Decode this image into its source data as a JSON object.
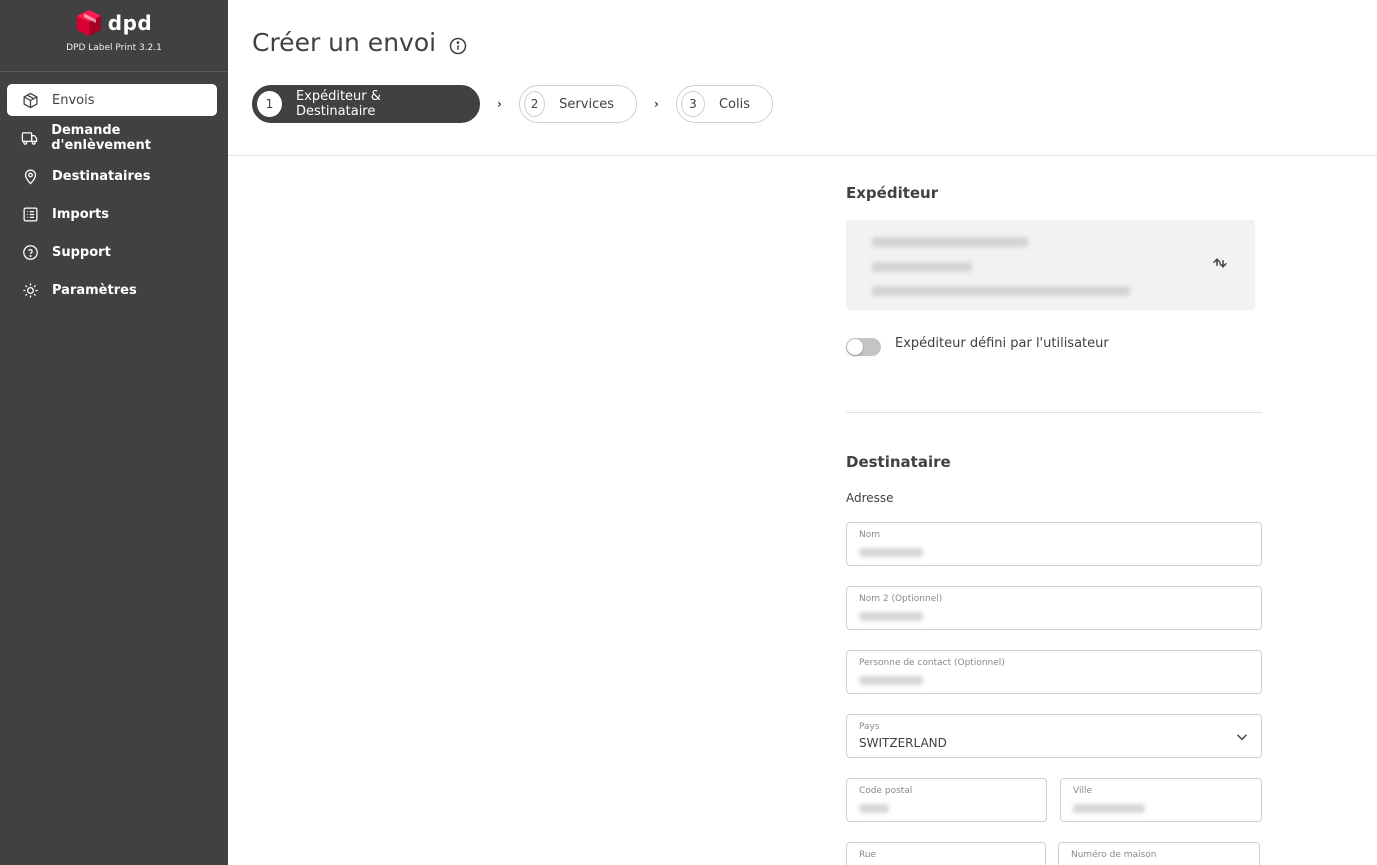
{
  "app": {
    "brand_name": "dpd",
    "version": "DPD Label Print 3.2.1"
  },
  "sidebar": {
    "items": [
      {
        "label": "Envois",
        "icon": "box-icon",
        "active": true
      },
      {
        "label": "Demande d'enlèvement",
        "icon": "truck-icon",
        "active": false
      },
      {
        "label": "Destinataires",
        "icon": "location-pin-icon",
        "active": false
      },
      {
        "label": "Imports",
        "icon": "list-icon",
        "active": false
      },
      {
        "label": "Support",
        "icon": "help-circle-icon",
        "active": false
      },
      {
        "label": "Paramètres",
        "icon": "gear-icon",
        "active": false
      }
    ]
  },
  "header": {
    "title": "Créer un envoi",
    "steps": [
      {
        "number": "1",
        "label": "Expéditeur & Destinataire",
        "active": true
      },
      {
        "number": "2",
        "label": "Services",
        "active": false
      },
      {
        "number": "3",
        "label": "Colis",
        "active": false
      }
    ]
  },
  "sender": {
    "title": "Expéditeur",
    "toggle_label": "Expéditeur défini par l'utilisateur",
    "toggle_on": false
  },
  "recipient": {
    "title": "Destinataire",
    "address_label": "Adresse",
    "fields": {
      "nom": {
        "label": "Nom"
      },
      "nom2": {
        "label": "Nom 2 (Optionnel)"
      },
      "contact": {
        "label": "Personne de contact (Optionnel)"
      },
      "pays": {
        "label": "Pays",
        "value": "SWITZERLAND"
      },
      "code_postal": {
        "label": "Code postal"
      },
      "ville": {
        "label": "Ville"
      },
      "rue": {
        "label": "Rue"
      },
      "numero": {
        "label": "Numéro de maison"
      }
    }
  },
  "colors": {
    "sidebar_bg": "#414042",
    "brand_red": "#dc0032",
    "active_step_bg": "#414042"
  }
}
